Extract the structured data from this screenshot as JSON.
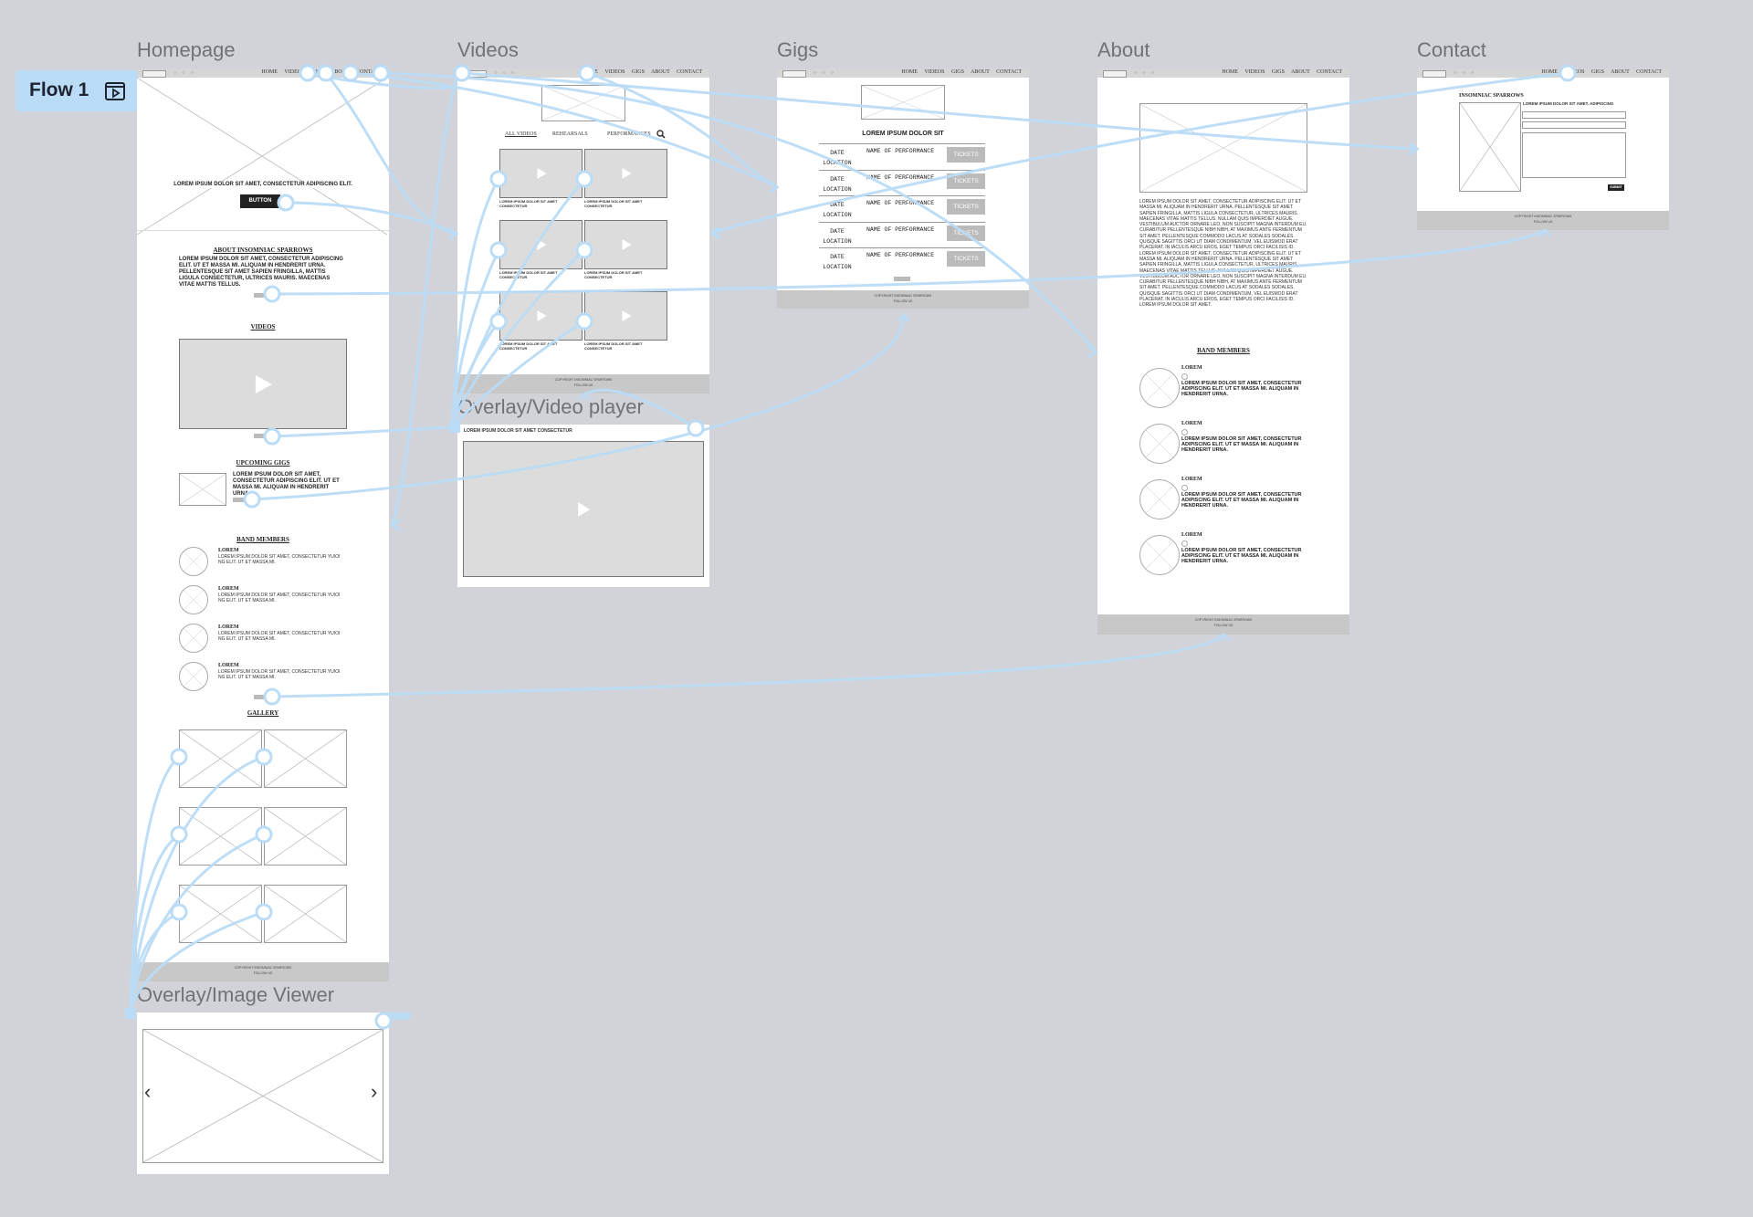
{
  "flow": {
    "label": "Flow 1",
    "icon": "play-frame-icon"
  },
  "nav_links": "HOME VIDEOS GIGS ABOUT CONTACT",
  "frames": {
    "homepage": {
      "title": "Homepage",
      "hero_text": "LOREM IPSUM DOLOR SIT AMET, CONSECTETUR ADIPISCING ELIT.",
      "hero_button": "BUTTON",
      "about_heading": "ABOUT INSOMNIAC SPARROWS",
      "about_text": "LOREM IPSUM DOLOR SIT AMET, CONSECTETUR ADIPISCING ELIT. UT ET MASSA MI. ALIQUAM IN HENDRERIT URNA. PELLENTESQUE SIT AMET SAPIEN FRINGILLA, MATTIS LIGULA CONSECTETUR, ULTRICES MAURIS. MAECENAS VITAE MATTIS TELLUS.",
      "videos_heading": "VIDEOS",
      "gigs_heading": "UPCOMING GIGS",
      "gigs_text": "LOREM IPSUM DOLOR SIT AMET, CONSECTETUR ADIPISCING ELIT. UT ET MASSA MI. ALIQUAM IN HENDRERIT URNA.",
      "members_heading": "BAND MEMBERS",
      "members": [
        {
          "name": "LOREM",
          "text": "LOREM IPSUM DOLOR SIT AMET, CONSECTETUR YUIOI NG ELIT. UT ET MASSA MI."
        },
        {
          "name": "LOREM",
          "text": "LOREM IPSUM DOLOR SIT AMET, CONSECTETUR YUIOI NG ELIT. UT ET MASSA MI."
        },
        {
          "name": "LOREM",
          "text": "LOREM IPSUM DOLOR SIT AMET, CONSECTETUR YUIOI NG ELIT. UT ET MASSA MI."
        },
        {
          "name": "LOREM",
          "text": "LOREM IPSUM DOLOR SIT AMET, CONSECTETUR YUIOI NG ELIT. UT ET MASSA MI."
        }
      ],
      "gallery_heading": "GALLERY",
      "footer_line1": "COPYRIGHT INSOMNIAC SPARROWS",
      "footer_line2": "FOLLOW US"
    },
    "videos": {
      "title": "Videos",
      "tabs": [
        "ALL VIDEOS",
        "REHEARSALS",
        "PERFORMANCES"
      ],
      "captions": [
        "LOREM IPSUM DOLOR SIT AMET CONSECTETUR",
        "LOREM IPSUM DOLOR SIT AMET CONSECTETUR",
        "LOREM IPSUM DOLOR SIT AMET CONSECTETUR",
        "LOREM IPSUM DOLOR SIT AMET CONSECTETUR",
        "LOREM IPSUM DOLOR SIT AMET CONSECTETUR",
        "LOREM IPSUM DOLOR SIT AMET CONSECTETUR"
      ],
      "footer_line1": "COPYRIGHT INSOMNIAC SPARROWS",
      "footer_line2": "FOLLOW US"
    },
    "video_player": {
      "title": "Overlay/Video player",
      "caption": "LOREM IPSUM DOLOR SIT AMET CONSECTETUR"
    },
    "gigs": {
      "title": "Gigs",
      "heading": "LOREM IPSUM DOLOR SIT",
      "rows": [
        {
          "date": "DATE",
          "location": "LOCATION",
          "performance": "NAME OF PERFORMANCE",
          "button": "TICKETS"
        },
        {
          "date": "DATE",
          "location": "LOCATION",
          "performance": "NAME OF PERFORMANCE",
          "button": "TICKETS"
        },
        {
          "date": "DATE",
          "location": "LOCATION",
          "performance": "NAME OF PERFORMANCE",
          "button": "TICKETS"
        },
        {
          "date": "DATE",
          "location": "LOCATION",
          "performance": "NAME OF PERFORMANCE",
          "button": "TICKETS"
        },
        {
          "date": "DATE",
          "location": "LOCATION",
          "performance": "NAME OF PERFORMANCE",
          "button": "TICKETS"
        }
      ],
      "footer_line1": "COPYRIGHT INSOMNIAC SPARROWS",
      "footer_line2": "FOLLOW US"
    },
    "about": {
      "title": "About",
      "body": "LOREM IPSUM DOLOR SIT AMET, CONSECTETUR ADIPISCING ELIT. UT ET MASSA MI. ALIQUAM IN HENDRERIT URNA. PELLENTESQUE SIT AMET SAPIEN FRINGILLA, MATTIS LIGULA CONSECTETUR, ULTRICES MAURIS. MAECENAS VITAE MATTIS TELLUS. NULLAM QUIS IMPERDIET AUGUE. VESTIBULUM AUCTOR ORNARE LEO, NON SUSCIPIT MAGNA INTERDUM EU. CURABITUR PELLENTESQUE NIBH NIBH, AT MAXIMUS ANTE FERMENTUM SIT AMET. PELLENTESQUE COMMODO LACUS AT SODALES SODALES. QUISQUE SAGITTIS ORCI UT DIAM CONDIMENTUM, VEL EUISMOD ERAT PLACERAT. IN IACULIS ARCU EROS, EGET TEMPUS ORCI FACILISIS ID. LOREM IPSUM DOLOR SIT AMET, CONSECTETUR ADIPISCING ELIT. UT ET MASSA MI. ALIQUAM IN HENDRERIT URNA. PELLENTESQUE SIT AMET SAPIEN FRINGILLA, MATTIS LIGULA CONSECTETUR, ULTRICES MAURIS. MAECENAS VITAE MATTIS TELLUS. NULLAM QUIS IMPERDIET AUGUE. VESTIBULUM AUCTOR ORNARE LEO, NON SUSCIPIT MAGNA INTERDUM EU. CURABITUR PELLENTESQUE NIBH NIBH, AT MAXIMUS ANTE FERMENTUM SIT AMET. PELLENTESQUE COMMODO LACUS AT SODALES SODALES. QUISQUE SAGITTIS ORCI UT DIAM CONDIMENTUM, VEL EUISMOD ERAT PLACERAT. IN IACULIS ARCU EROS, EGET TEMPUS ORCI FACILISIS ID. LOREM IPSUM DOLOR SIT AMET.",
      "members_heading": "BAND MEMBERS",
      "members": [
        {
          "name": "LOREM",
          "text": "LOREM IPSUM DOLOR SIT AMET, CONSECTETUR ADIPISCING ELIT. UT ET MASSA MI. ALIQUAM IN HENDRERIT URNA."
        },
        {
          "name": "LOREM",
          "text": "LOREM IPSUM DOLOR SIT AMET, CONSECTETUR ADIPISCING ELIT. UT ET MASSA MI. ALIQUAM IN HENDRERIT URNA."
        },
        {
          "name": "LOREM",
          "text": "LOREM IPSUM DOLOR SIT AMET, CONSECTETUR ADIPISCING ELIT. UT ET MASSA MI. ALIQUAM IN HENDRERIT URNA."
        },
        {
          "name": "LOREM",
          "text": "LOREM IPSUM DOLOR SIT AMET, CONSECTETUR ADIPISCING ELIT. UT ET MASSA MI. ALIQUAM IN HENDRERIT URNA."
        }
      ],
      "footer_line1": "COPYRIGHT INSOMNIAC SPARROWS",
      "footer_line2": "FOLLOW US"
    },
    "contact": {
      "title": "Contact",
      "heading": "INSOMNIAC SPARROWS",
      "subtitle": "LOREM IPSUM DOLOR SIT AMET. ADIPISCING",
      "submit": "SUBMIT",
      "footer_line1": "COPYRIGHT INSOMNIAC SPARROWS",
      "footer_line2": "FOLLOW US"
    },
    "image_viewer": {
      "title": "Overlay/Image Viewer",
      "prev": "‹",
      "next": "›"
    }
  },
  "colors": {
    "canvas": "#d1d3d8",
    "connector": "#bbdcf6",
    "flow_badge": "#bbdcf6"
  }
}
